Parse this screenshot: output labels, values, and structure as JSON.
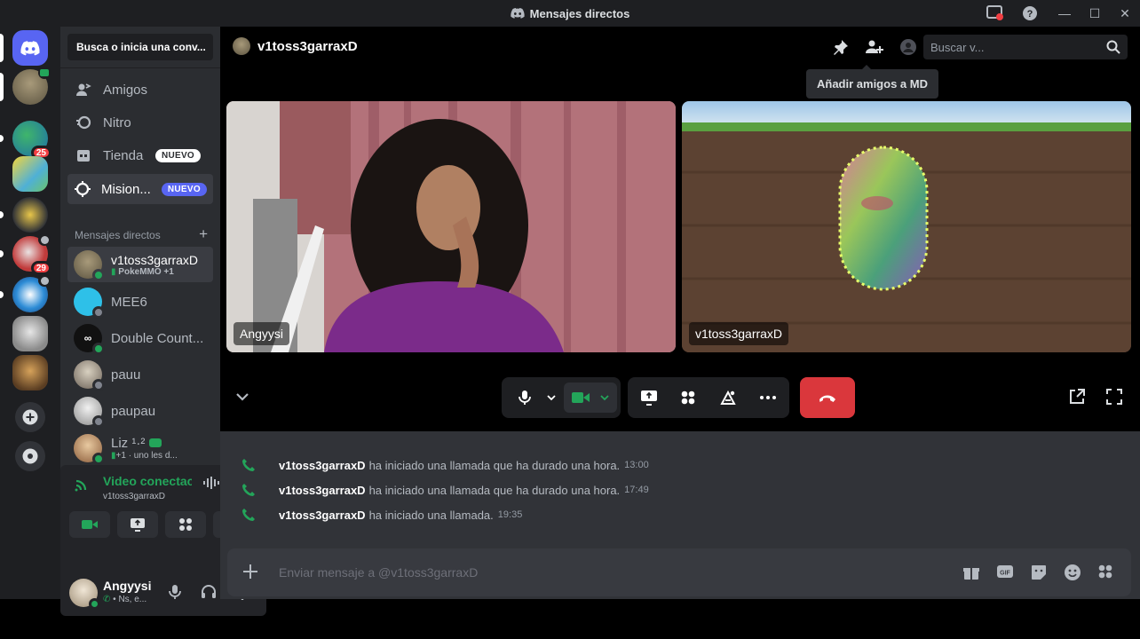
{
  "window": {
    "title": "Mensajes directos"
  },
  "sidebar": {
    "search_label": "Busca o inicia una conv...",
    "nav": [
      {
        "label": "Amigos",
        "icon": "friends-icon"
      },
      {
        "label": "Nitro",
        "icon": "nitro-icon"
      },
      {
        "label": "Tienda",
        "icon": "shop-icon",
        "badge": "NUEVO"
      },
      {
        "label": "Mision...",
        "icon": "quests-icon",
        "badge": "NUEVO"
      }
    ],
    "dm_header": "Mensajes directos",
    "dms": [
      {
        "name": "v1toss3garraxD",
        "sub": "PokeMMO +1",
        "status": "online"
      },
      {
        "name": "MEE6",
        "sub": "",
        "status": "offline"
      },
      {
        "name": "Double Count...",
        "sub": "",
        "status": "online"
      },
      {
        "name": "pauu",
        "sub": "",
        "status": "offline"
      },
      {
        "name": "paupau",
        "sub": "",
        "status": "offline"
      },
      {
        "name": "Liz ¹·²",
        "sub": "+1 · uno les d...",
        "status": "online"
      }
    ]
  },
  "servers": {
    "badges": [
      "25",
      "29"
    ]
  },
  "voice": {
    "title": "Video conectac",
    "subtitle": "v1toss3garraxD"
  },
  "user": {
    "name": "Angyysi",
    "status": "Ns, e..."
  },
  "header": {
    "channel": "v1toss3garraxD",
    "search_placeholder": "Buscar v...",
    "tooltip": "Añadir amigos a MD"
  },
  "call": {
    "tiles": [
      {
        "label": "Angyysi"
      },
      {
        "label": "v1toss3garraxD"
      }
    ]
  },
  "messages": [
    {
      "user": "v1toss3garraxD",
      "text": "ha iniciado una llamada que ha durado una hora.",
      "time": "13:00"
    },
    {
      "user": "v1toss3garraxD",
      "text": "ha iniciado una llamada que ha durado una hora.",
      "time": "17:49"
    },
    {
      "user": "v1toss3garraxD",
      "text": "ha iniciado una llamada.",
      "time": "19:35"
    }
  ],
  "composer": {
    "placeholder": "Enviar mensaje a @v1toss3garraxD"
  },
  "colors": {
    "accent": "#5865f2",
    "online": "#23a55a",
    "danger": "#da373c"
  }
}
